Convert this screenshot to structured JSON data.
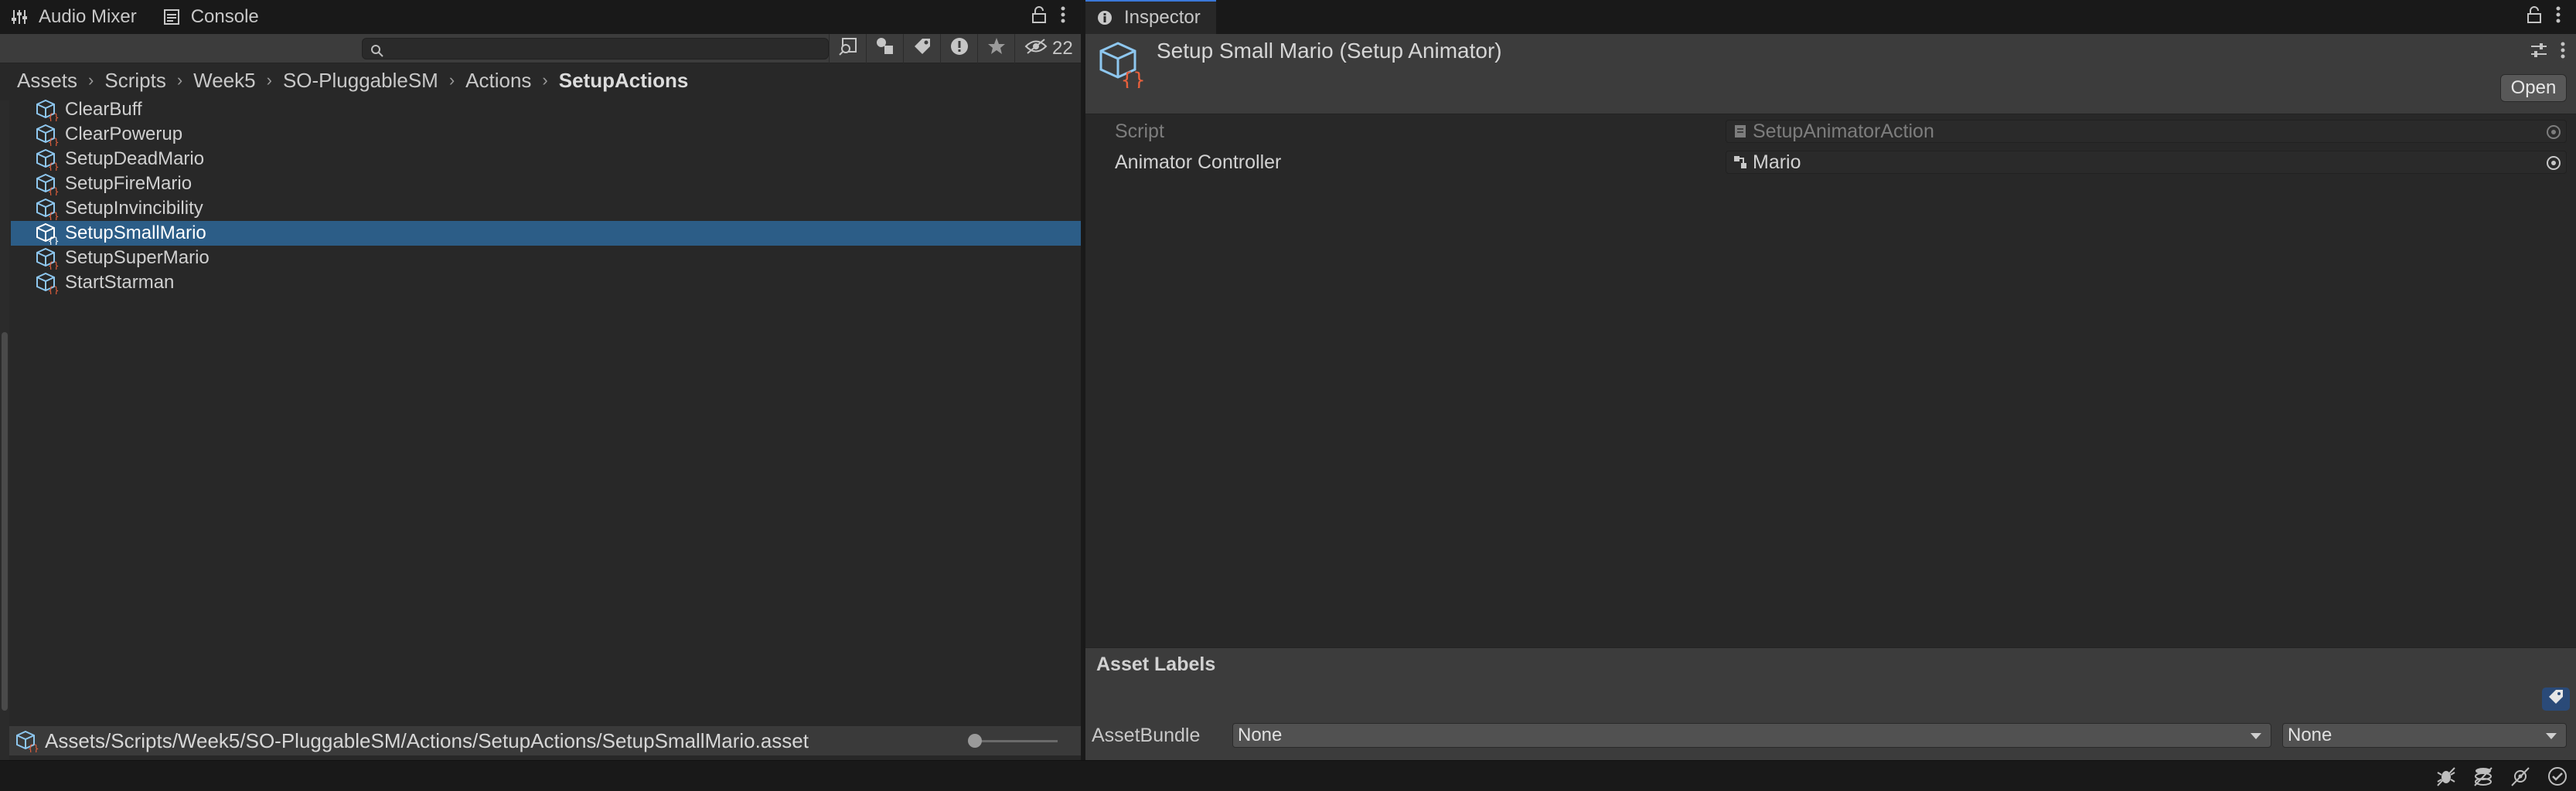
{
  "left_panel": {
    "tabs": [
      {
        "label": "Audio Mixer",
        "icon": "audio-mixer-icon"
      },
      {
        "label": "Console",
        "icon": "console-icon"
      }
    ],
    "toolbar": {
      "search_value": "",
      "hidden_count": "22"
    },
    "breadcrumb": [
      "Assets",
      "Scripts",
      "Week5",
      "SO-PluggableSM",
      "Actions",
      "SetupActions"
    ],
    "files": [
      {
        "name": "ClearBuff",
        "selected": false
      },
      {
        "name": "ClearPowerup",
        "selected": false
      },
      {
        "name": "SetupDeadMario",
        "selected": false
      },
      {
        "name": "SetupFireMario",
        "selected": false
      },
      {
        "name": "SetupInvincibility",
        "selected": false
      },
      {
        "name": "SetupSmallMario",
        "selected": true
      },
      {
        "name": "SetupSuperMario",
        "selected": false
      },
      {
        "name": "StartStarman",
        "selected": false
      }
    ],
    "status_path": "Assets/Scripts/Week5/SO-PluggableSM/Actions/SetupActions/SetupSmallMario.asset"
  },
  "inspector": {
    "tab_label": "Inspector",
    "title": "Setup Small Mario (Setup Animator)",
    "open_label": "Open",
    "properties": [
      {
        "label": "Script",
        "value": "SetupAnimatorAction",
        "disabled": true
      },
      {
        "label": "Animator Controller",
        "value": "Mario",
        "disabled": false
      }
    ],
    "asset_labels_title": "Asset Labels",
    "asset_bundle_label": "AssetBundle",
    "asset_bundle_value": "None",
    "asset_bundle_variant": "None"
  },
  "colors": {
    "selection": "#2c5d87",
    "panel": "#282828",
    "header": "#3c3c3c",
    "accent": "#3a78d8"
  }
}
